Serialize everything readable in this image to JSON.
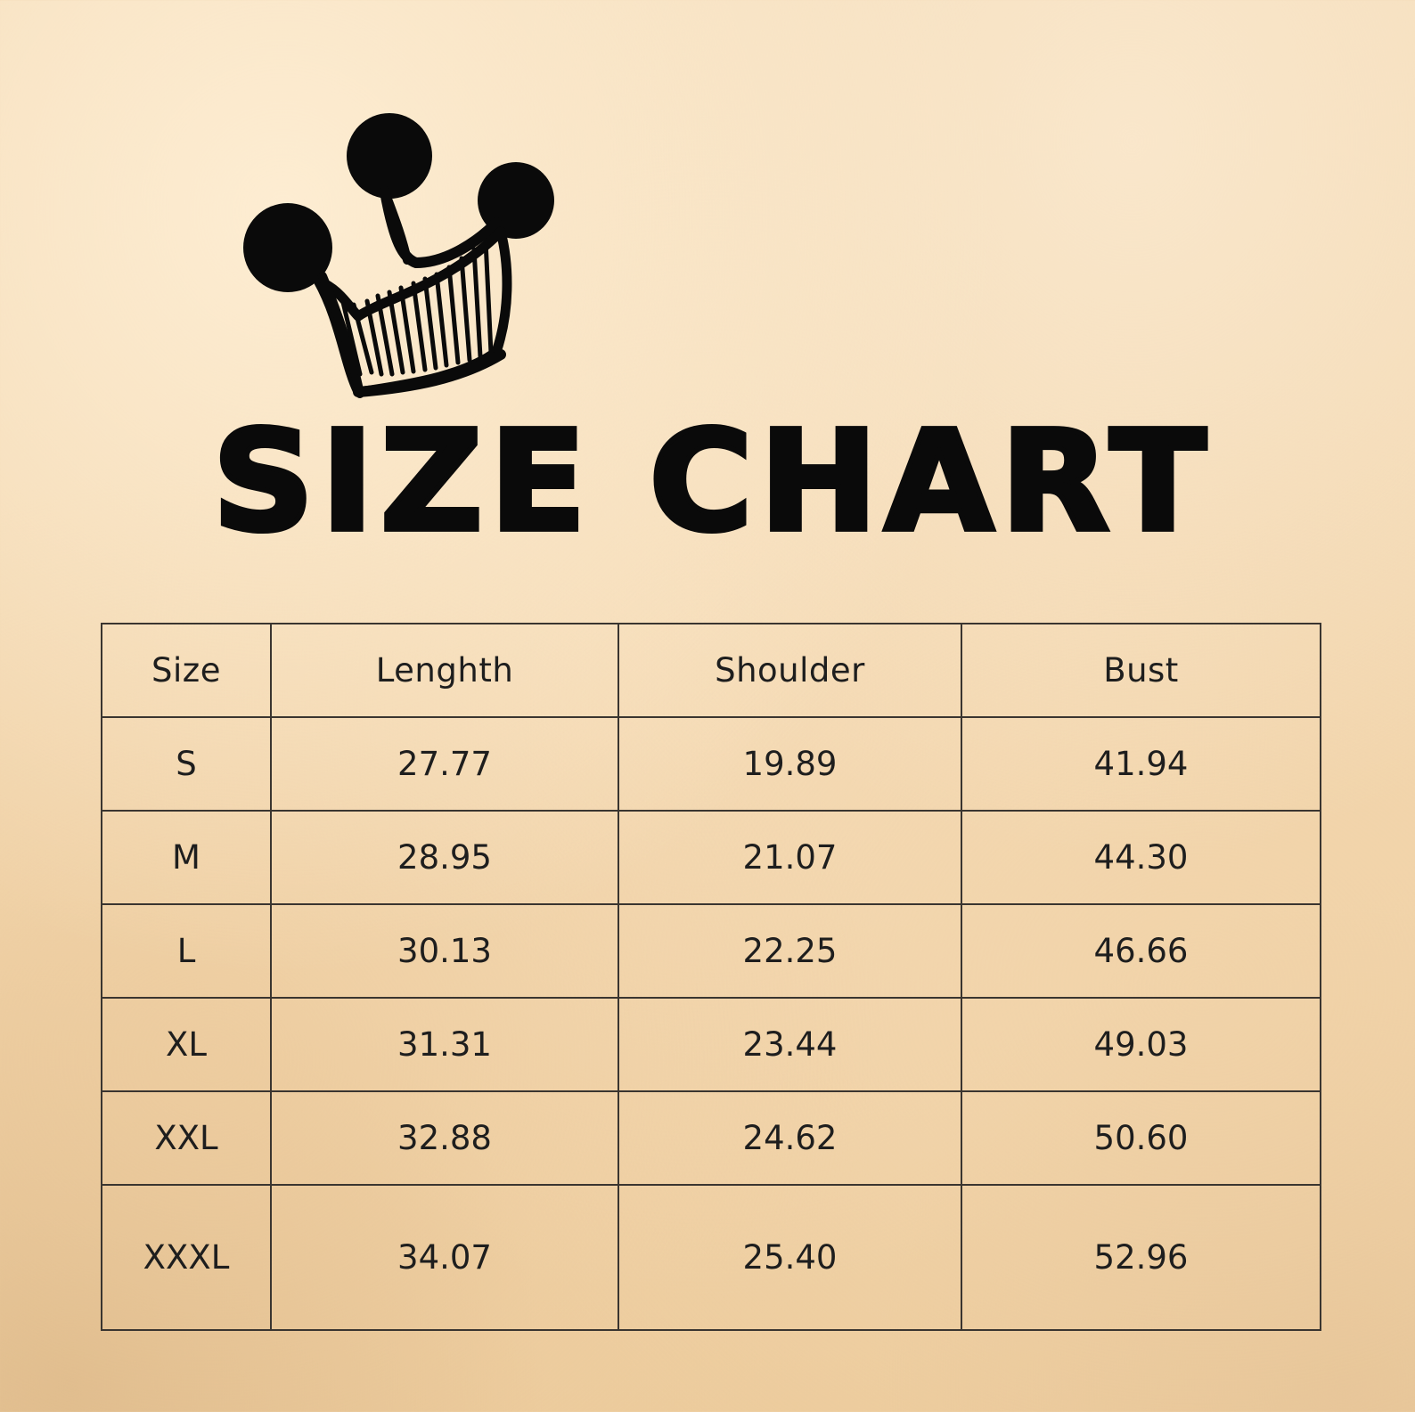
{
  "title": "SIZE CHART",
  "table": {
    "headers": [
      "Size",
      "Lenghth",
      "Shoulder",
      "Bust"
    ],
    "rows": [
      [
        "S",
        "27.77",
        "19.89",
        "41.94"
      ],
      [
        "M",
        "28.95",
        "21.07",
        "44.30"
      ],
      [
        "L",
        "30.13",
        "22.25",
        "46.66"
      ],
      [
        "XL",
        "31.31",
        "23.44",
        "49.03"
      ],
      [
        "XXL",
        "32.88",
        "24.62",
        "50.60"
      ],
      [
        "XXXL",
        "34.07",
        "25.40",
        "52.96"
      ]
    ]
  },
  "icons": {
    "crown": "crown-icon"
  },
  "colors": {
    "background": "#f2d6ae",
    "text": "#0a0a0a",
    "border": "#3a3530"
  }
}
